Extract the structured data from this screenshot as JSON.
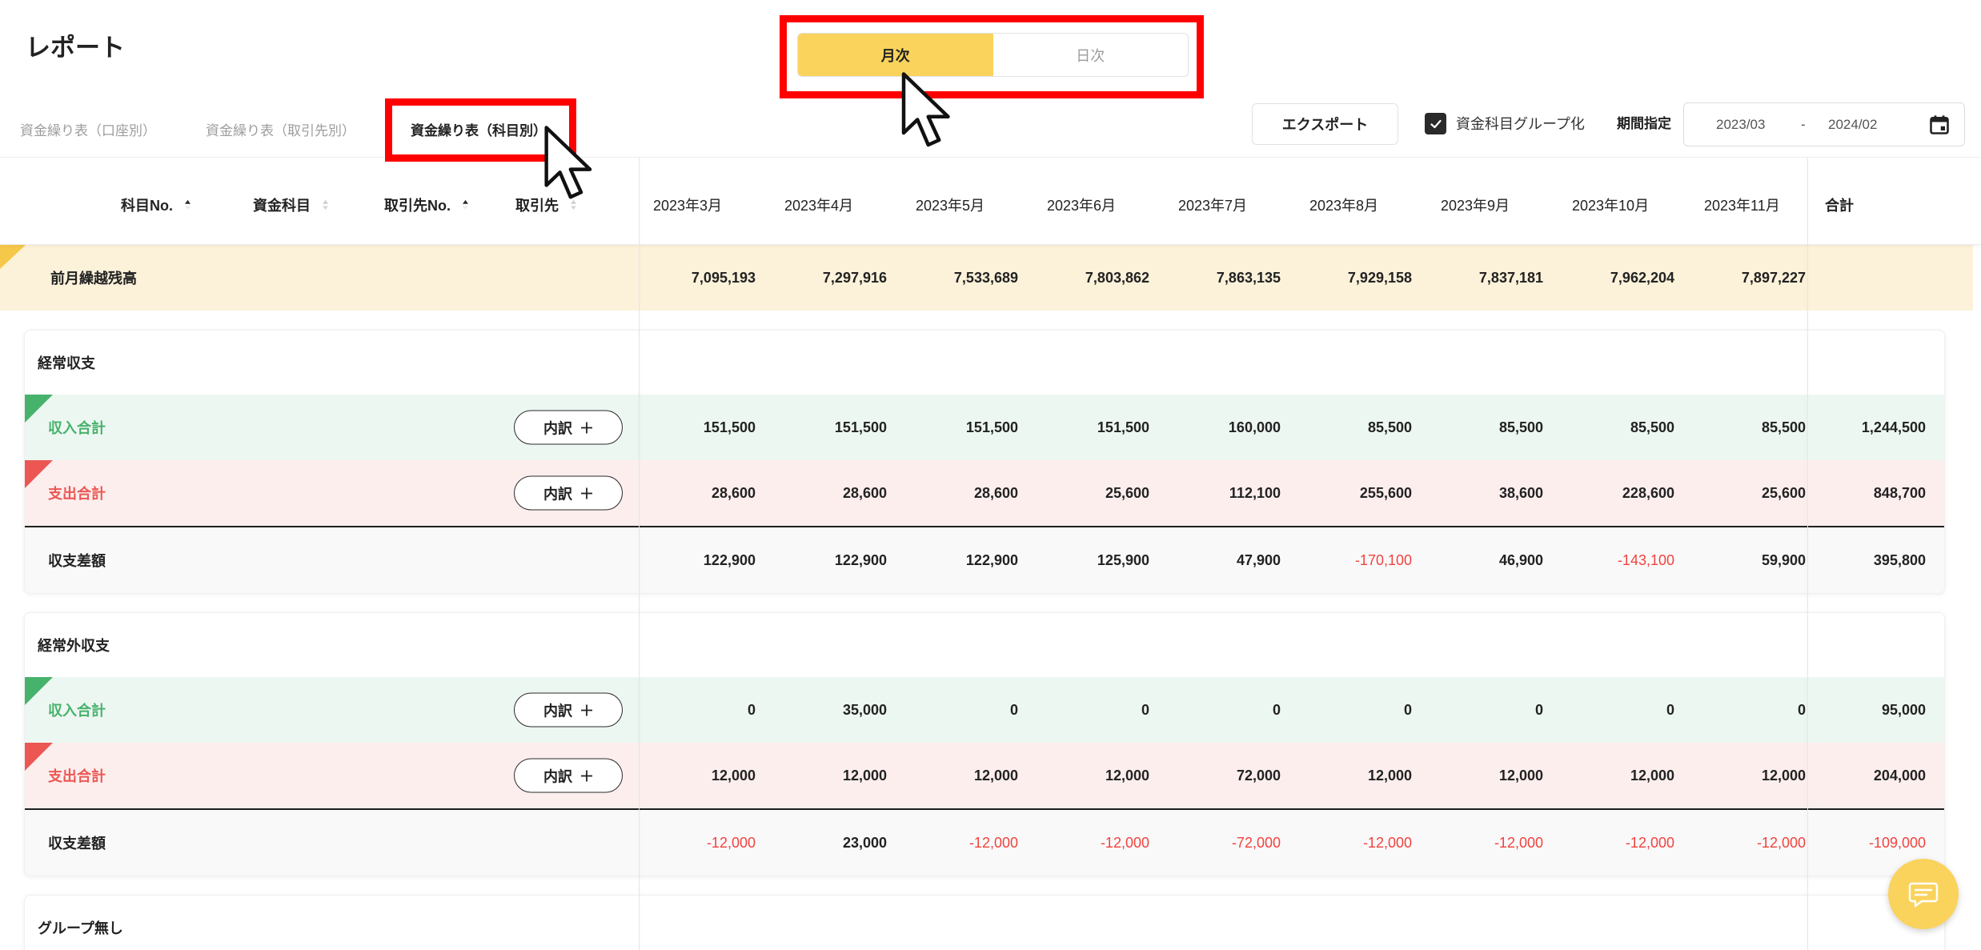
{
  "page": {
    "title": "レポート"
  },
  "view_toggle": {
    "options": [
      {
        "label": "月次",
        "selected": true
      },
      {
        "label": "日次",
        "selected": false
      }
    ]
  },
  "tabs": [
    {
      "label": "資金繰り表（口座別）",
      "active": false
    },
    {
      "label": "資金繰り表（取引先別）",
      "active": false
    },
    {
      "label": "資金繰り表（科目別）",
      "active": true
    }
  ],
  "toolbar": {
    "export_label": "エクスポート",
    "group_toggle": {
      "label": "資金科目グループ化",
      "checked": true
    },
    "period_label": "期間指定",
    "period_start": "2023/03",
    "period_separator": "-",
    "period_end": "2024/02"
  },
  "table": {
    "left_headers": [
      {
        "label": "科目No.",
        "sort": "asc"
      },
      {
        "label": "資金科目",
        "sort": "none"
      },
      {
        "label": "取引先No.",
        "sort": "asc"
      },
      {
        "label": "取引先",
        "sort": "none"
      }
    ],
    "month_headers": [
      "2023年3月",
      "2023年4月",
      "2023年5月",
      "2023年6月",
      "2023年7月",
      "2023年8月",
      "2023年9月",
      "2023年10月",
      "2023年11月"
    ],
    "total_header": "合計",
    "carryover": {
      "label": "前月繰越残高",
      "values": [
        "7,095,193",
        "7,297,916",
        "7,533,689",
        "7,803,862",
        "7,863,135",
        "7,929,158",
        "7,837,181",
        "7,962,204",
        "7,897,227"
      ],
      "total": ""
    },
    "sections": [
      {
        "title": "経常収支",
        "rows": [
          {
            "kind": "income",
            "label": "収入合計",
            "breakdown_label": "内訳",
            "values": [
              "151,500",
              "151,500",
              "151,500",
              "151,500",
              "160,000",
              "85,500",
              "85,500",
              "85,500",
              "85,500"
            ],
            "total": "1,244,500"
          },
          {
            "kind": "expense",
            "label": "支出合計",
            "breakdown_label": "内訳",
            "values": [
              "28,600",
              "28,600",
              "28,600",
              "25,600",
              "112,100",
              "255,600",
              "38,600",
              "228,600",
              "25,600"
            ],
            "total": "848,700"
          },
          {
            "kind": "net",
            "label": "収支差額",
            "values": [
              "122,900",
              "122,900",
              "122,900",
              "125,900",
              "47,900",
              "-170,100",
              "46,900",
              "-143,100",
              "59,900"
            ],
            "total": "395,800"
          }
        ]
      },
      {
        "title": "経常外収支",
        "rows": [
          {
            "kind": "income",
            "label": "収入合計",
            "breakdown_label": "内訳",
            "values": [
              "0",
              "35,000",
              "0",
              "0",
              "0",
              "0",
              "0",
              "0",
              "0"
            ],
            "total": "95,000"
          },
          {
            "kind": "expense",
            "label": "支出合計",
            "breakdown_label": "内訳",
            "values": [
              "12,000",
              "12,000",
              "12,000",
              "12,000",
              "72,000",
              "12,000",
              "12,000",
              "12,000",
              "12,000"
            ],
            "total": "204,000"
          },
          {
            "kind": "net",
            "label": "収支差額",
            "values": [
              "-12,000",
              "23,000",
              "-12,000",
              "-12,000",
              "-72,000",
              "-12,000",
              "-12,000",
              "-12,000",
              "-12,000"
            ],
            "total": "-109,000"
          }
        ]
      },
      {
        "title": "グループ無し",
        "rows": []
      }
    ]
  },
  "icons": {
    "sort": "sort-icon",
    "check": "check-icon",
    "calendar": "calendar-icon",
    "breakdown": "plus-icon",
    "chat": "chat-icon",
    "pointer": "mouse-pointer-icon"
  },
  "colors": {
    "accent_yellow": "#fad35d",
    "highlight_red": "#ff0000",
    "income_green": "#47b26c",
    "expense_red": "#ec5753",
    "negative_red": "#f2433d",
    "carryover_bg": "#fcf2da",
    "carryover_marker": "#f6c84a",
    "income_bg": "#edf7f1",
    "expense_bg": "#fdeeee",
    "net_bg": "#f9f9fa"
  }
}
